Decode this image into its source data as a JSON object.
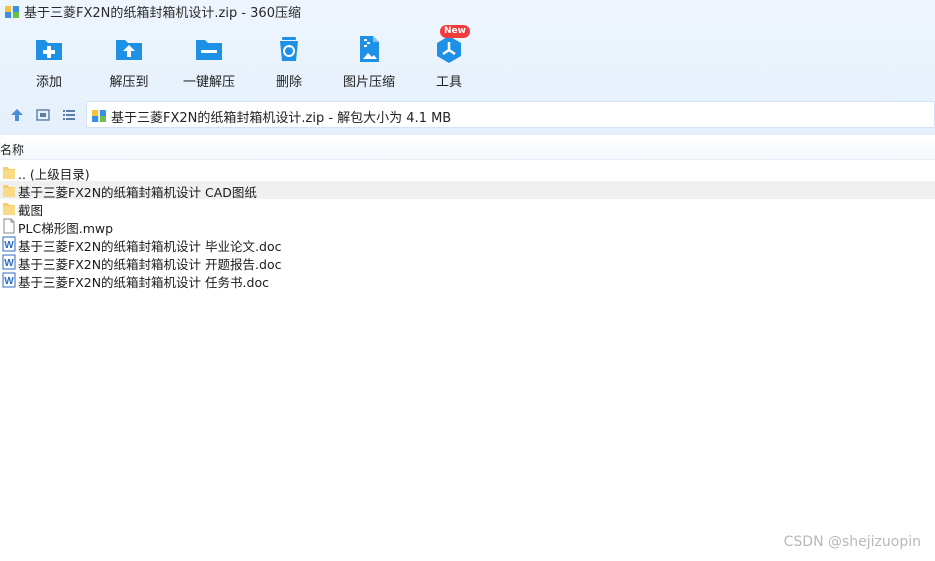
{
  "window": {
    "title": "基于三菱FX2N的纸箱封箱机设计.zip - 360压缩"
  },
  "toolbar": {
    "add_label": "添加",
    "extract_to_label": "解压到",
    "one_click_extract_label": "一键解压",
    "delete_label": "删除",
    "image_compress_label": "图片压缩",
    "tools_label": "工具",
    "tools_badge": "New"
  },
  "address": {
    "text": "基于三菱FX2N的纸箱封箱机设计.zip - 解包大小为 4.1 MB"
  },
  "columns": {
    "name": "名称"
  },
  "files": [
    {
      "name": ".. (上级目录)",
      "icon": "folder-icon"
    },
    {
      "name": "基于三菱FX2N的纸箱封箱机设计 CAD图纸",
      "icon": "folder-icon"
    },
    {
      "name": "截图",
      "icon": "folder-icon"
    },
    {
      "name": "PLC梯形图.mwp",
      "icon": "file-icon"
    },
    {
      "name": "基于三菱FX2N的纸箱封箱机设计 毕业论文.doc",
      "icon": "word-doc-icon"
    },
    {
      "name": "基于三菱FX2N的纸箱封箱机设计 开题报告.doc",
      "icon": "word-doc-icon"
    },
    {
      "name": "基于三菱FX2N的纸箱封箱机设计 任务书.doc",
      "icon": "word-doc-icon"
    }
  ],
  "watermark": "CSDN @shejizuopin",
  "colors": {
    "accent": "#1e90e6",
    "toolbar_bg": "#eaf3fd",
    "folder": "#f6cf6a",
    "word": "#2b6cc4",
    "badge": "#ef3b3b"
  }
}
